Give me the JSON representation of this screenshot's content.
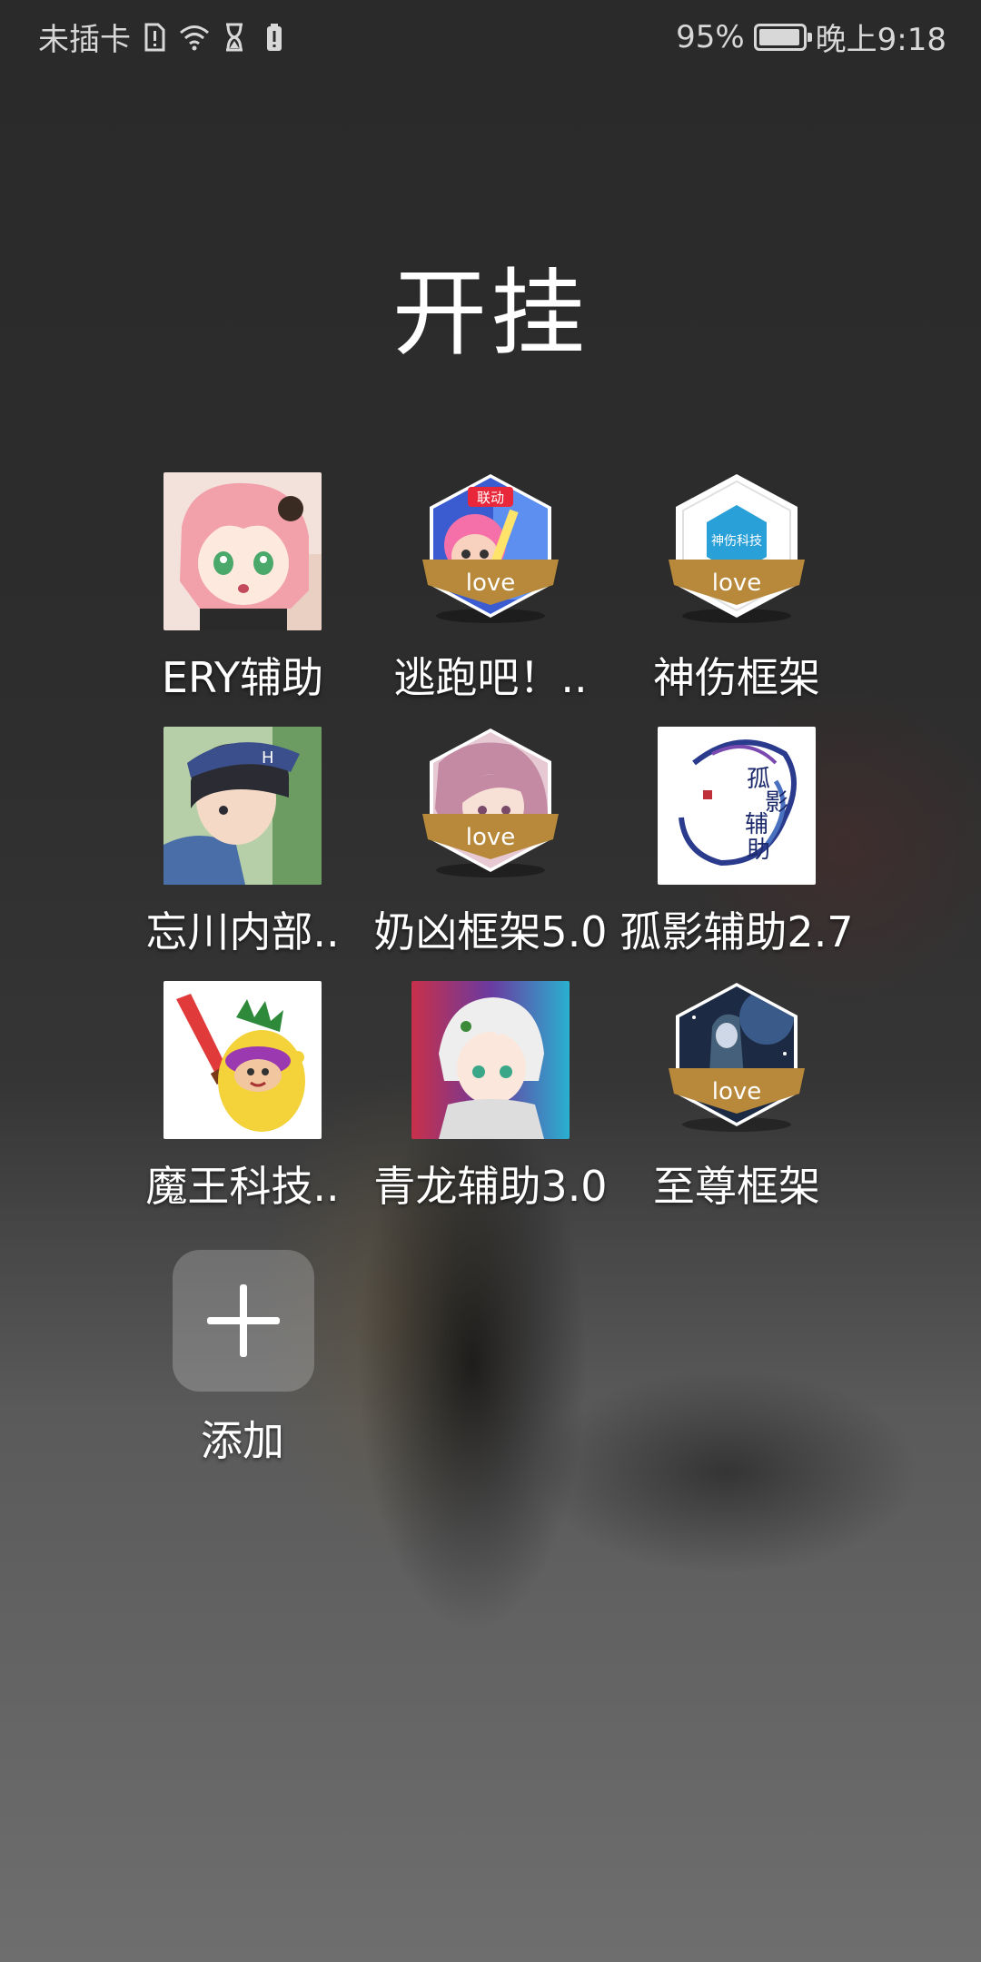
{
  "status_bar": {
    "carrier": "未插卡",
    "battery_percent_text": "95%",
    "battery_level": 0.95,
    "time": "晚上9:18"
  },
  "folder": {
    "title": "开挂"
  },
  "apps": [
    {
      "label": "ERY辅助",
      "icon": "anime-girl-pink-hair-icon",
      "style": "square"
    },
    {
      "label": "逃跑吧！..",
      "icon": "game-character-hex-icon",
      "style": "hex",
      "badge": "love",
      "corner_tag": "联动"
    },
    {
      "label": "神伤框架",
      "icon": "blue-hex-logo-icon",
      "style": "hex",
      "badge": "love",
      "inner_text": "神伤科技"
    },
    {
      "label": "忘川内部..",
      "icon": "anime-boy-cap-icon",
      "style": "square"
    },
    {
      "label": "奶凶框架5.0",
      "icon": "anime-pink-hair-hex-icon",
      "style": "hex",
      "badge": "love"
    },
    {
      "label": "孤影辅助2.7",
      "icon": "calligraphy-dragon-logo-icon",
      "style": "square",
      "inner_text": "孤影辅助"
    },
    {
      "label": "魔王科技..",
      "icon": "pineapple-mascot-icon",
      "style": "square"
    },
    {
      "label": "青龙辅助3.0",
      "icon": "anime-white-hair-boy-icon",
      "style": "square"
    },
    {
      "label": "至尊框架",
      "icon": "night-scene-hex-icon",
      "style": "hex",
      "badge": "love"
    }
  ],
  "add": {
    "label": "添加",
    "icon": "plus-icon"
  },
  "colors": {
    "hex_frame_gold": "#b8893a",
    "badge_text": "#ffffff"
  }
}
